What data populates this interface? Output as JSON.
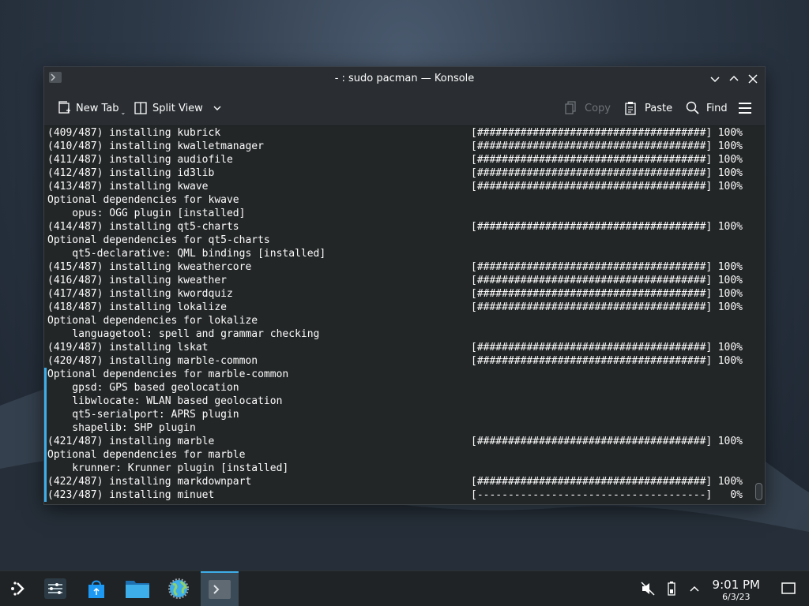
{
  "window": {
    "title": "- : sudo pacman — Konsole"
  },
  "toolbar": {
    "new_tab": "New Tab",
    "split_view": "Split View",
    "copy": "Copy",
    "paste": "Paste",
    "find": "Find"
  },
  "terminal": {
    "lines": [
      {
        "text": "(409/487) installing kubrick",
        "bar": "[#####################################]",
        "pct": "100%"
      },
      {
        "text": "(410/487) installing kwalletmanager",
        "bar": "[#####################################]",
        "pct": "100%"
      },
      {
        "text": "(411/487) installing audiofile",
        "bar": "[#####################################]",
        "pct": "100%"
      },
      {
        "text": "(412/487) installing id3lib",
        "bar": "[#####################################]",
        "pct": "100%"
      },
      {
        "text": "(413/487) installing kwave",
        "bar": "[#####################################]",
        "pct": "100%"
      },
      {
        "text": "Optional dependencies for kwave",
        "bar": "",
        "pct": ""
      },
      {
        "text": "    opus: OGG plugin [installed]",
        "bar": "",
        "pct": ""
      },
      {
        "text": "(414/487) installing qt5-charts",
        "bar": "[#####################################]",
        "pct": "100%"
      },
      {
        "text": "Optional dependencies for qt5-charts",
        "bar": "",
        "pct": ""
      },
      {
        "text": "    qt5-declarative: QML bindings [installed]",
        "bar": "",
        "pct": ""
      },
      {
        "text": "(415/487) installing kweathercore",
        "bar": "[#####################################]",
        "pct": "100%"
      },
      {
        "text": "(416/487) installing kweather",
        "bar": "[#####################################]",
        "pct": "100%"
      },
      {
        "text": "(417/487) installing kwordquiz",
        "bar": "[#####################################]",
        "pct": "100%"
      },
      {
        "text": "(418/487) installing lokalize",
        "bar": "[#####################################]",
        "pct": "100%"
      },
      {
        "text": "Optional dependencies for lokalize",
        "bar": "",
        "pct": ""
      },
      {
        "text": "    languagetool: spell and grammar checking",
        "bar": "",
        "pct": ""
      },
      {
        "text": "(419/487) installing lskat",
        "bar": "[#####################################]",
        "pct": "100%"
      },
      {
        "text": "(420/487) installing marble-common",
        "bar": "[#####################################]",
        "pct": "100%"
      },
      {
        "text": "Optional dependencies for marble-common",
        "bar": "",
        "pct": ""
      },
      {
        "text": "    gpsd: GPS based geolocation",
        "bar": "",
        "pct": ""
      },
      {
        "text": "    libwlocate: WLAN based geolocation",
        "bar": "",
        "pct": ""
      },
      {
        "text": "    qt5-serialport: APRS plugin",
        "bar": "",
        "pct": ""
      },
      {
        "text": "    shapelib: SHP plugin",
        "bar": "",
        "pct": ""
      },
      {
        "text": "(421/487) installing marble",
        "bar": "[#####################################]",
        "pct": "100%"
      },
      {
        "text": "Optional dependencies for marble",
        "bar": "",
        "pct": ""
      },
      {
        "text": "    krunner: Krunner plugin [installed]",
        "bar": "",
        "pct": ""
      },
      {
        "text": "(422/487) installing markdownpart",
        "bar": "[#####################################]",
        "pct": "100%"
      },
      {
        "text": "(423/487) installing minuet",
        "bar": "[-------------------------------------]",
        "pct": "0%"
      }
    ]
  },
  "taskbar": {
    "time": "9:01 PM",
    "date": "6/3/23"
  },
  "colors": {
    "accent": "#3daee9",
    "terminal_bg": "#232627",
    "terminal_fg": "#fcfcfc"
  }
}
